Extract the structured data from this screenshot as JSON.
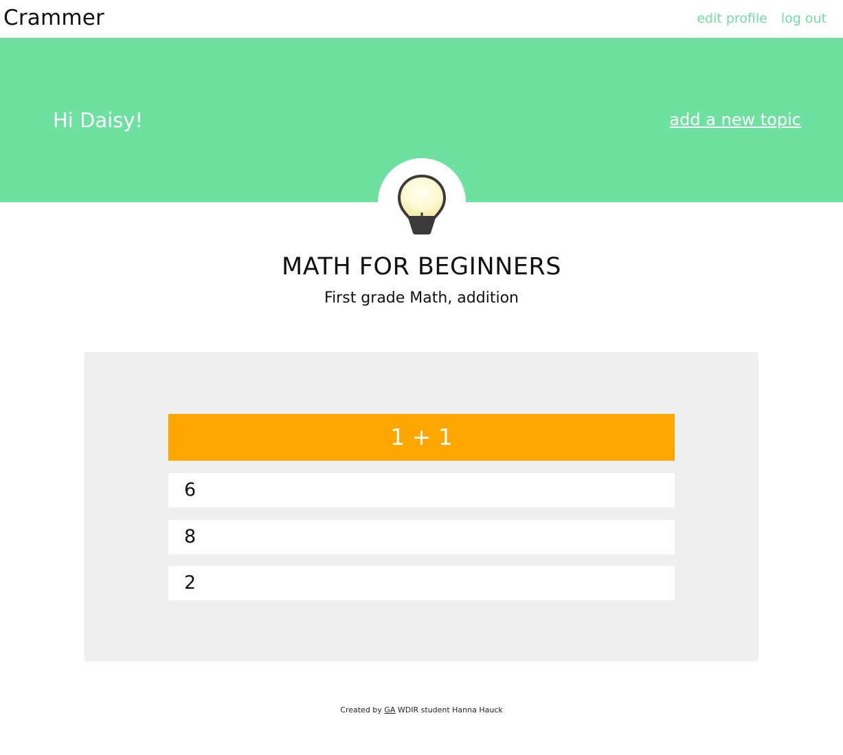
{
  "header": {
    "brand": "Crammer",
    "nav": {
      "edit_profile": "edit profile",
      "log_out": "log out"
    }
  },
  "hero": {
    "greeting": "Hi Daisy!",
    "add_topic": "add a new topic",
    "icon": "lightbulb-icon"
  },
  "topic": {
    "title": "MATH FOR BEGINNERS",
    "subtitle": "First grade Math, addition"
  },
  "quiz": {
    "question": "1 + 1",
    "answers": [
      "6",
      "8",
      "2"
    ]
  },
  "footer": {
    "prefix": "Created by",
    "link": "GA",
    "suffix": "WDIR student Hanna Hauck"
  },
  "colors": {
    "accent_green": "#6ee0a0",
    "question_orange": "#ffa600",
    "panel_gray": "#efefef"
  }
}
